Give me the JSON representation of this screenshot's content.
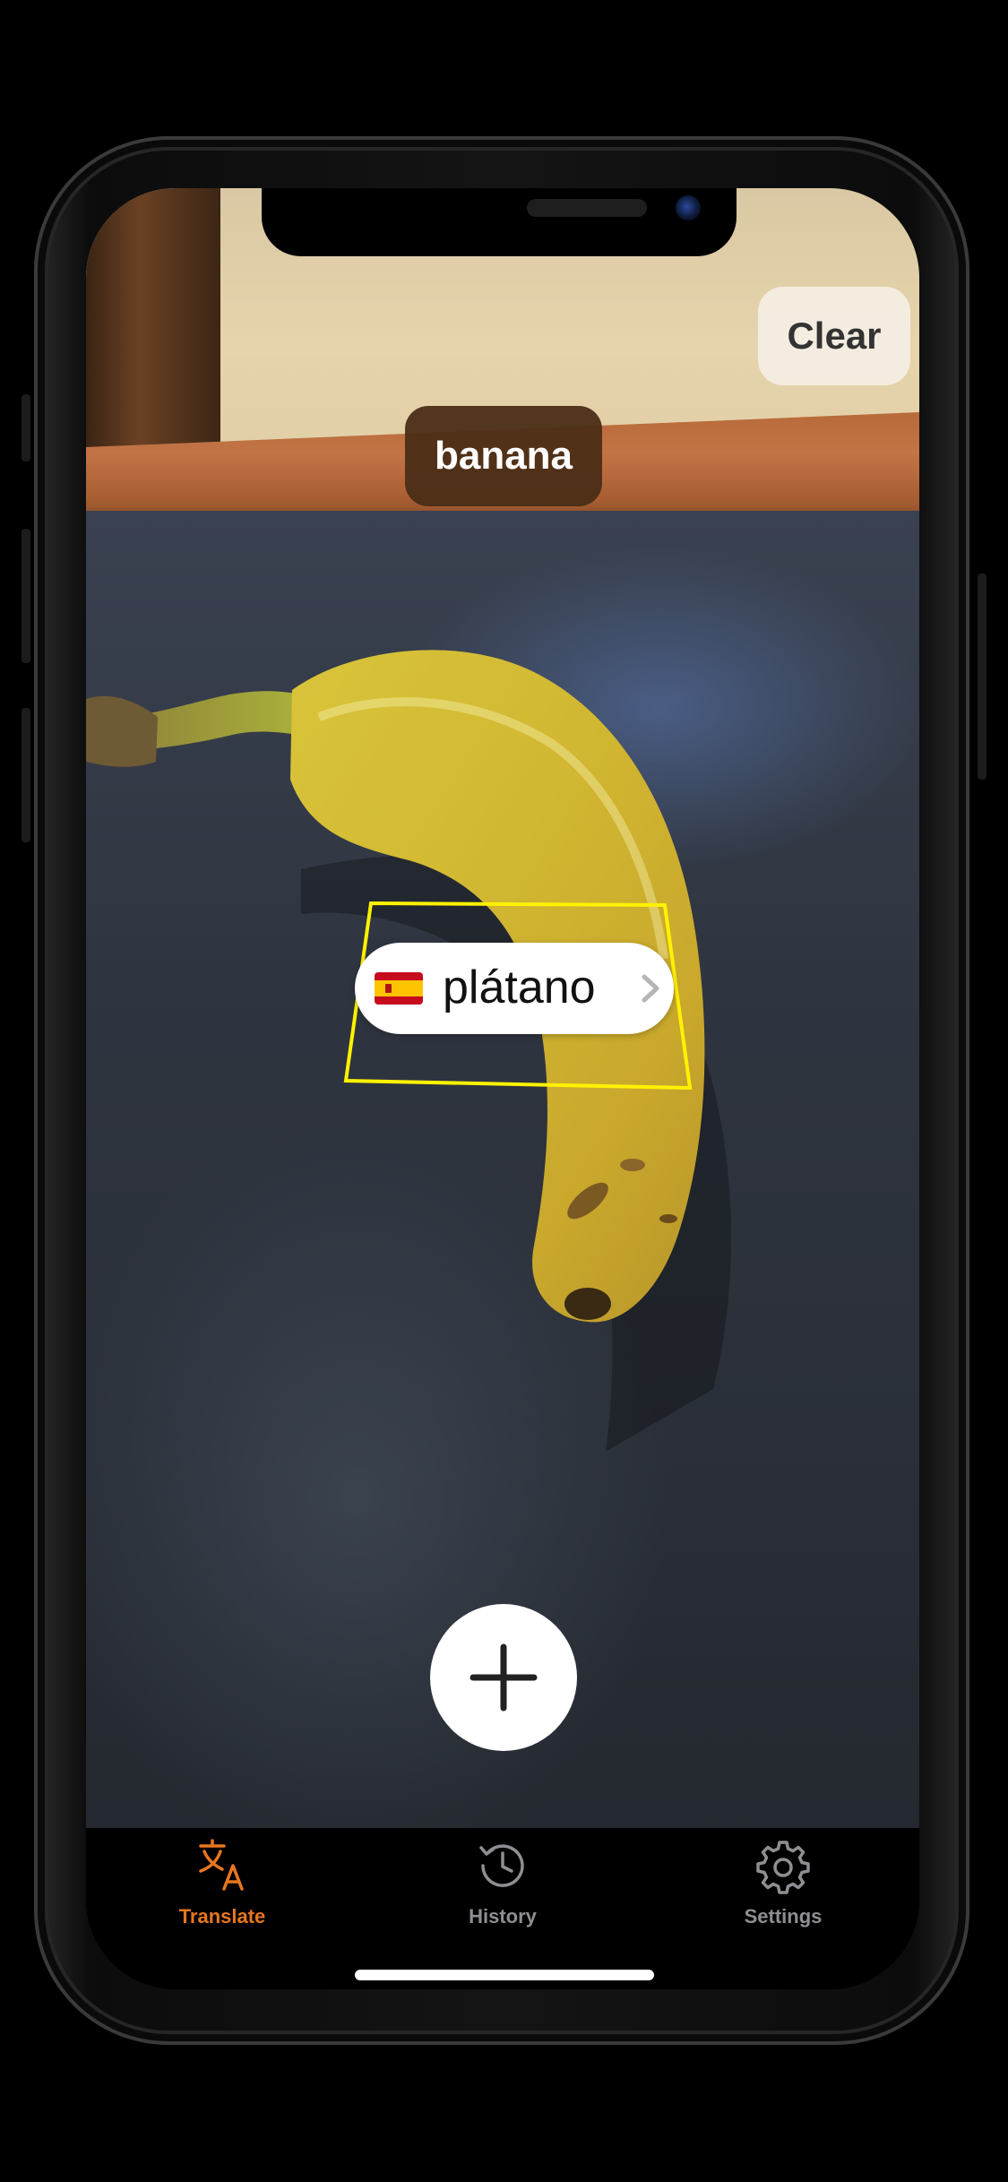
{
  "scene": {
    "detected_label": "banana",
    "translation": {
      "flag_icon": "spain-flag-icon",
      "text": "plátano"
    }
  },
  "toolbar": {
    "clear_label": "Clear",
    "add_icon": "plus-icon"
  },
  "tabs": [
    {
      "label": "Translate",
      "icon": "translate-icon",
      "active": true,
      "color": "#E8761E"
    },
    {
      "label": "History",
      "icon": "history-clock-icon",
      "active": false,
      "color": "#8E8E93"
    },
    {
      "label": "Settings",
      "icon": "gear-icon",
      "active": false,
      "color": "#8E8E93"
    }
  ],
  "colors": {
    "accent": "#E8761E",
    "detection_box": "#FFF200",
    "label_chip": "#4B2D16"
  }
}
